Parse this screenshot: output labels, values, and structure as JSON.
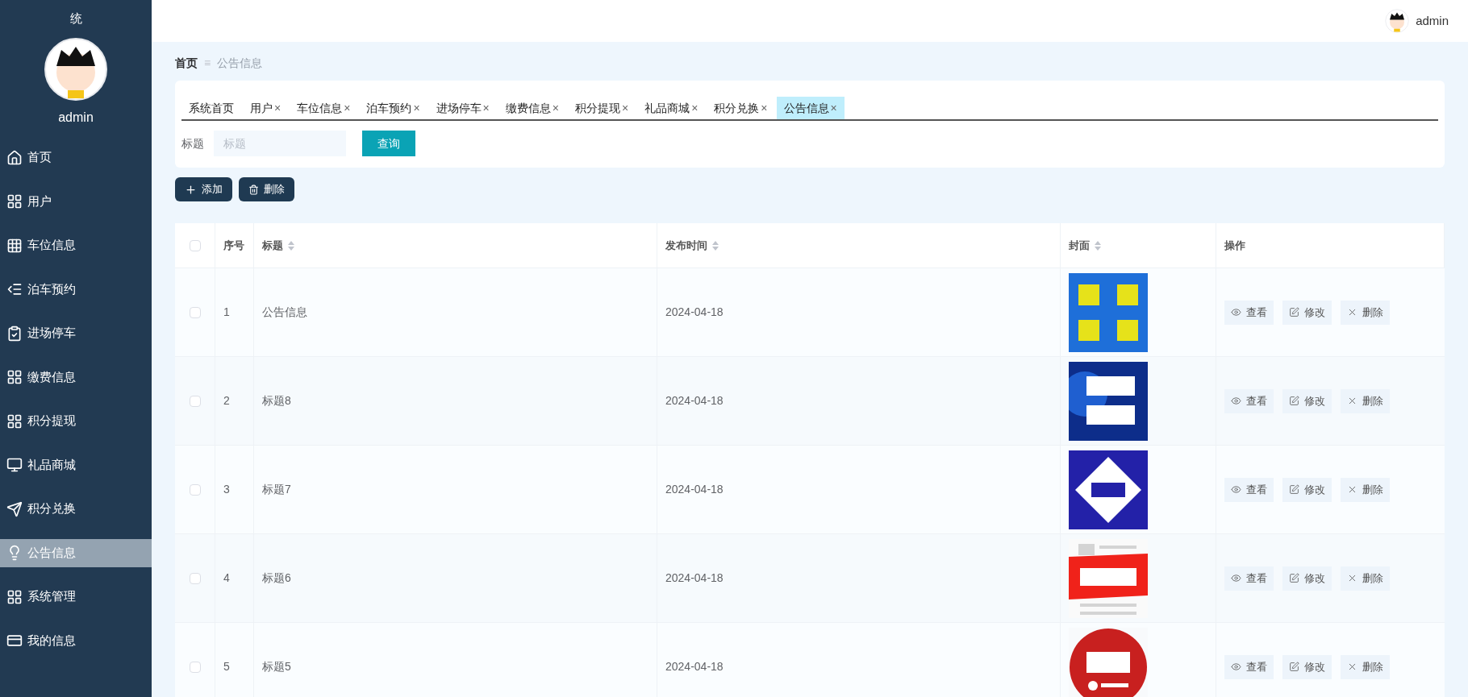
{
  "sidebar": {
    "title": "统",
    "user": "admin",
    "items": [
      {
        "label": "首页",
        "selected": false
      },
      {
        "label": "用户",
        "selected": false
      },
      {
        "label": "车位信息",
        "selected": false
      },
      {
        "label": "泊车预约",
        "selected": false
      },
      {
        "label": "进场停车",
        "selected": false
      },
      {
        "label": "缴费信息",
        "selected": false
      },
      {
        "label": "积分提现",
        "selected": false
      },
      {
        "label": "礼品商城",
        "selected": false
      },
      {
        "label": "积分兑换",
        "selected": false
      },
      {
        "label": "公告信息",
        "selected": true
      },
      {
        "label": "系统管理",
        "selected": false
      },
      {
        "label": "我的信息",
        "selected": false
      }
    ]
  },
  "topbar": {
    "user": "admin"
  },
  "breadcrumb": {
    "home": "首页",
    "separator": "≡",
    "current": "公告信息"
  },
  "tabs": [
    {
      "label": "系统首页",
      "selected": false
    },
    {
      "label": "用户",
      "close": "×",
      "selected": false
    },
    {
      "label": "车位信息",
      "close": "×",
      "selected": false
    },
    {
      "label": "泊车预约",
      "close": "×",
      "selected": false
    },
    {
      "label": "进场停车",
      "close": "×",
      "selected": false
    },
    {
      "label": "缴费信息",
      "close": "×",
      "selected": false
    },
    {
      "label": "积分提现",
      "close": "×",
      "selected": false
    },
    {
      "label": "礼品商城",
      "close": "×",
      "selected": false
    },
    {
      "label": "积分兑换",
      "close": "×",
      "selected": false
    },
    {
      "label": "公告信息",
      "close": "×",
      "selected": true
    }
  ],
  "search": {
    "label": "标题",
    "placeholder": "标题",
    "button": "查询"
  },
  "actions": [
    {
      "label": "添加",
      "kind": "add"
    },
    {
      "label": "删除",
      "kind": "delete"
    }
  ],
  "table": {
    "select_all_checked": false,
    "columns": [
      {
        "label": "序号",
        "sortable": false
      },
      {
        "label": "标题",
        "sortable": true
      },
      {
        "label": "发布时间",
        "sortable": true
      },
      {
        "label": "封面",
        "sortable": true
      },
      {
        "label": "操作",
        "sortable": false
      }
    ],
    "rows": [
      {
        "index": "1",
        "title": "公告信息",
        "date": "2024-04-18",
        "checked": false,
        "buttons": [
          {
            "label": "查看",
            "kind": "view"
          },
          {
            "label": "修改",
            "kind": "edit"
          },
          {
            "label": "删除",
            "kind": "delete"
          }
        ]
      },
      {
        "index": "2",
        "title": "标题8",
        "date": "2024-04-18",
        "checked": false,
        "buttons": [
          {
            "label": "查看",
            "kind": "view"
          },
          {
            "label": "修改",
            "kind": "edit"
          },
          {
            "label": "删除",
            "kind": "delete"
          }
        ]
      },
      {
        "index": "3",
        "title": "标题7",
        "date": "2024-04-18",
        "checked": false,
        "buttons": [
          {
            "label": "查看",
            "kind": "view"
          },
          {
            "label": "修改",
            "kind": "edit"
          },
          {
            "label": "删除",
            "kind": "delete"
          }
        ]
      },
      {
        "index": "4",
        "title": "标题6",
        "date": "2024-04-18",
        "checked": false,
        "buttons": [
          {
            "label": "查看",
            "kind": "view"
          },
          {
            "label": "修改",
            "kind": "edit"
          },
          {
            "label": "删除",
            "kind": "delete"
          }
        ]
      },
      {
        "index": "5",
        "title": "标题5",
        "date": "2024-04-18",
        "checked": false,
        "buttons": [
          {
            "label": "查看",
            "kind": "view"
          },
          {
            "label": "修改",
            "kind": "edit"
          },
          {
            "label": "删除",
            "kind": "delete"
          }
        ]
      }
    ]
  }
}
